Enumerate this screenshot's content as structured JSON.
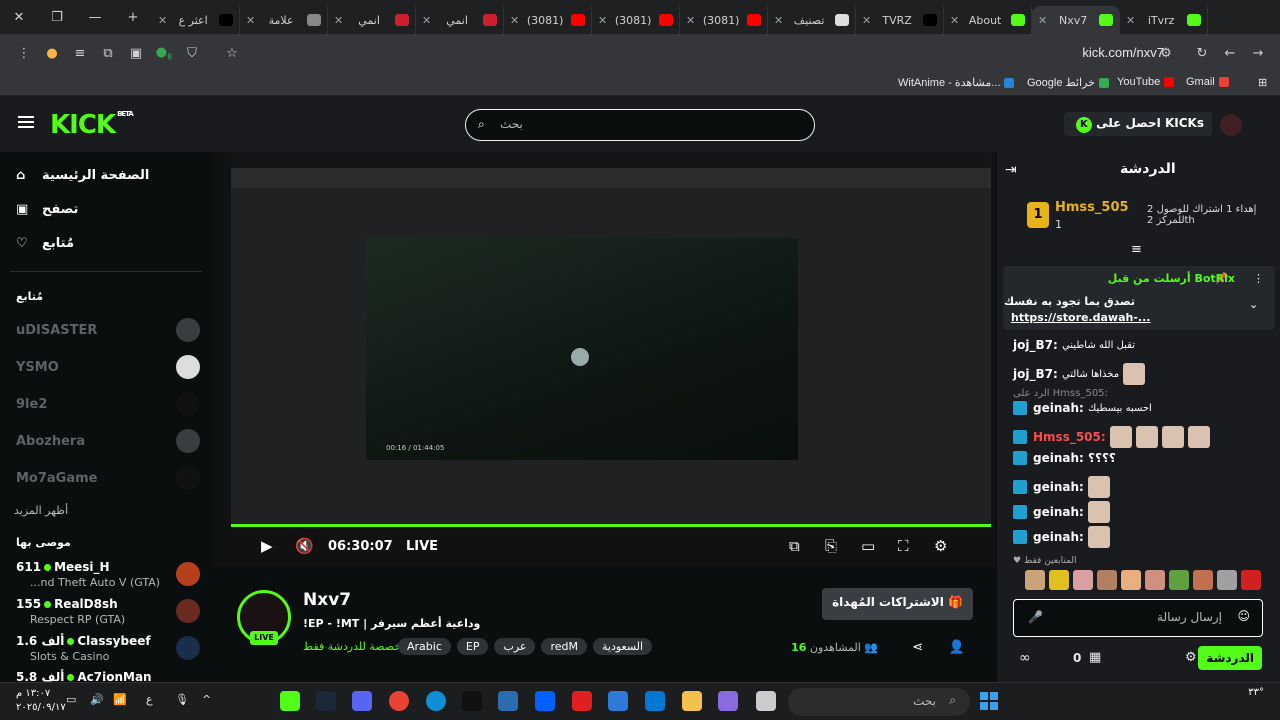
{
  "browser": {
    "tabs": [
      {
        "title": "اعثر ع",
        "color": "#000000"
      },
      {
        "title": "علامة",
        "color": "#888888"
      },
      {
        "title": "انمي",
        "color": "#cc2030"
      },
      {
        "title": "انمي",
        "color": "#cc2030"
      },
      {
        "title": "(3081)",
        "color": "#ff0000"
      },
      {
        "title": "(3081)",
        "color": "#ff0000"
      },
      {
        "title": "(3081)",
        "color": "#ff0000"
      },
      {
        "title": "تصنيف",
        "color": "#dddddd"
      },
      {
        "title": "TVRZ",
        "color": "#000000"
      },
      {
        "title": "About",
        "color": "#53fc18"
      },
      {
        "title": "Nxv7",
        "color": "#53fc18"
      },
      {
        "title": "iTvrz",
        "color": "#53fc18"
      }
    ],
    "url": "kick.com/nxv7",
    "bookmarks": [
      {
        "label": "WitAnime - مشاهدة...",
        "color": "#2b80d8"
      },
      {
        "label": "Google خرائط",
        "color": "#34a853"
      },
      {
        "label": "YouTube",
        "color": "#ff0000"
      },
      {
        "label": "Gmail",
        "color": "#ea4335"
      }
    ],
    "extension_badge": "8"
  },
  "header": {
    "logo": "KICK",
    "logo_sup": "BETA",
    "search_placeholder": "بحث",
    "get_kicks": "احصل على KICKs"
  },
  "sidebar": {
    "nav": [
      {
        "label": "الصفحة الرئيسية",
        "icon": "home-icon"
      },
      {
        "label": "تصفح",
        "icon": "browse-icon"
      },
      {
        "label": "مُتابع",
        "icon": "heart-icon"
      }
    ],
    "following_title": "مُتابع",
    "following": [
      "uDISASTER",
      "YSMO",
      "9le2",
      "Abozhera",
      "Mo7aGame"
    ],
    "show_more": "أظهر المزيد",
    "recommended_title": "موصى بها",
    "recommended": [
      {
        "count": "611",
        "name": "Meesi_H",
        "game": "...nd Theft Auto V (GTA)",
        "color": "#b5411c"
      },
      {
        "count": "155",
        "name": "RealD8sh",
        "game": "Respect RP (GTA)",
        "color": "#6b2a20"
      },
      {
        "count": "1.6 ألف",
        "name": "Classybeef",
        "game": "Slots & Casino",
        "color": "#1a2d4a"
      },
      {
        "count": "5.8 ألف",
        "name": "Ac7ionMan",
        "game": "",
        "color": "#2a2a2a"
      }
    ]
  },
  "player": {
    "time": "06:30:07",
    "live": "LIVE",
    "inner_time": "00:16 / 01:44:05"
  },
  "stream": {
    "streamer": "Nxv7",
    "live_badge": "LIVE",
    "title": "!EP - !MT | وداعية أعظم سيرفر",
    "subtitle": "مخصصة للدردشة فقط",
    "tags": [
      "Arabic",
      "EP",
      "عرب",
      "redM",
      "السعودية"
    ],
    "gift_button": "الاشتراكات المُهداة",
    "viewers_label": "المشاهدون",
    "viewers": "16"
  },
  "chat": {
    "title": "الدردشة",
    "gifter_rank": "1",
    "gifter_name": "Hmss_505",
    "gifter_count": "1",
    "gifter_desc": "إهداء 1 اشتراك للوصول للمركز 2th",
    "gifter_rank2": "2",
    "pinned_by": "أرسلت من قبل BotRix",
    "pinned_msg": "تصدق بما تجود به نفسك",
    "pinned_link": "https://store.dawah-...",
    "messages": [
      {
        "user": "joj_B7:",
        "text": "تقبل الله شاطيني",
        "color": "#ffffff"
      },
      {
        "user": "joj_B7:",
        "text": "مخذاها شالتي",
        "color": "#ffffff"
      },
      {
        "user": "geinah:",
        "text": "احسبه بيسطيك",
        "color": "#ffffff"
      },
      {
        "user": "Hmss_505:",
        "text": "",
        "color": "#ff4b4b"
      },
      {
        "user": "geinah:",
        "text": "؟؟؟؟",
        "color": "#ffffff"
      },
      {
        "user": "geinah:",
        "text": "",
        "color": "#ffffff"
      },
      {
        "user": "geinah:",
        "text": "",
        "color": "#ffffff"
      },
      {
        "user": "geinah:",
        "text": "",
        "color": "#ffffff"
      }
    ],
    "reply_note": "الرد على Hmss_505:",
    "followers_only": "المتابعين فقط",
    "input_placeholder": "إرسال رسالة",
    "send": "الدردشة",
    "points": "0",
    "infinity": "∞"
  },
  "taskbar": {
    "time": "١٣:٠٧ م",
    "date": "٢٠٢٥/٠٩/١٧",
    "search": "بحث",
    "temp": "٣٣°",
    "lang": "ع"
  }
}
